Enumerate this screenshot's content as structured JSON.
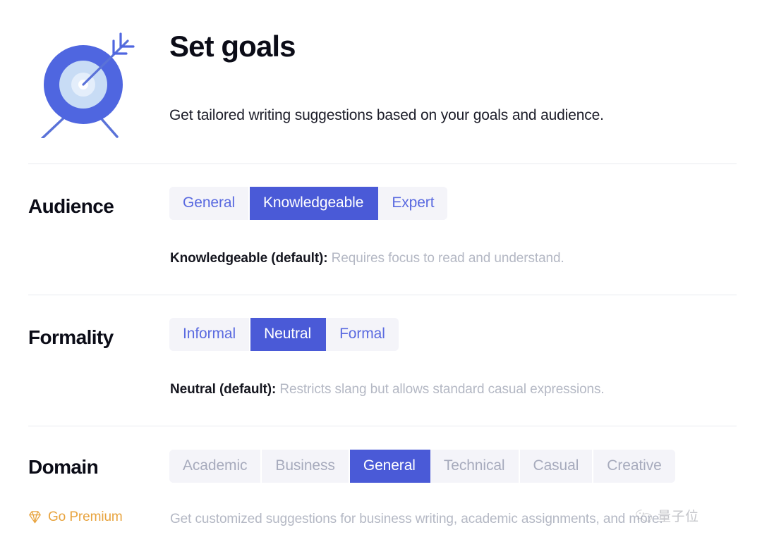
{
  "header": {
    "icon": "target-with-arrow-icon",
    "title": "Set goals",
    "subtitle": "Get tailored writing suggestions based on your goals and audience."
  },
  "settings": [
    {
      "key": "audience",
      "label": "Audience",
      "options": [
        "General",
        "Knowledgeable",
        "Expert"
      ],
      "selected": "Knowledgeable",
      "locked": false,
      "description_strong": "Knowledgeable (default):",
      "description_rest": " Requires focus to read and understand."
    },
    {
      "key": "formality",
      "label": "Formality",
      "options": [
        "Informal",
        "Neutral",
        "Formal"
      ],
      "selected": "Neutral",
      "locked": false,
      "description_strong": "Neutral (default):",
      "description_rest": " Restricts slang but allows standard casual expressions."
    },
    {
      "key": "domain",
      "label": "Domain",
      "options": [
        "Academic",
        "Business",
        "General",
        "Technical",
        "Casual",
        "Creative"
      ],
      "selected": "General",
      "locked": true,
      "description_strong": "",
      "description_rest": "Get customized suggestions for business writing, academic assignments, and more."
    }
  ],
  "premium": {
    "icon": "diamond-icon",
    "label": "Go Premium"
  },
  "watermark": {
    "icon": "wechat-icon",
    "text": "量子位"
  },
  "colors": {
    "accent_selected": "#4a5ad7",
    "segment_background": "#f4f4f9",
    "segment_text": "#5a6ae0",
    "segment_text_muted": "#a7abbd",
    "description_text": "#b4b8c4",
    "premium_gold": "#e8a33d",
    "divider": "#e8eaee",
    "title_text": "#0b0c17"
  }
}
